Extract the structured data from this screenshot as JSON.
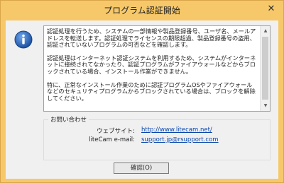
{
  "window": {
    "title": "プログラム認証開始",
    "close_glyph": "✕",
    "frame_color": "#f6c86a"
  },
  "message": {
    "paragraphs": [
      "認証処理を行うため、システムの一部情報や製品登録番号、ユーザ名、メールアドレスを転送します。認証処理でライセンスの期限超過、製品登録番号の盗用、認証されていないプログラムの可否などを確認します。",
      "認証処理はインターネット認証システムを利用するため、システムがインターネットに接続されてなかったり、認証プログラムがファイアウォールなどからブロックされている場合、インストール作業ができません。",
      "特に、正常なインストール作業のために認証プログラムOSやファイアウォールなどのセキュリティプログラムからブロックされている場合は、ブロックを解除してください。"
    ]
  },
  "icon": {
    "name": "info-icon",
    "color": "#1f5fb5"
  },
  "contact": {
    "legend": "お問い合わせ",
    "website_label": "ウェブサイト:",
    "website_value": "http://www.litecam.net/",
    "email_label": "liteCam e-mail:",
    "email_value": "support.jp@rsupport.com"
  },
  "buttons": {
    "ok_label": "確認(O)"
  }
}
